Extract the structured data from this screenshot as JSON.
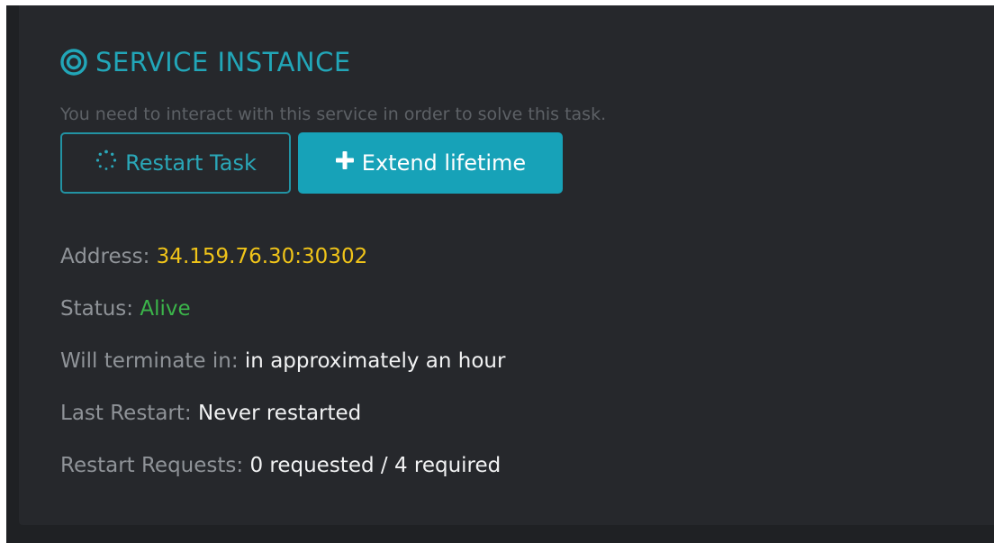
{
  "card": {
    "title": "SERVICE INSTANCE",
    "subtitle": "You need to interact with this service in order to solve this task."
  },
  "buttons": {
    "restart_label": "Restart Task",
    "extend_label": "Extend lifetime"
  },
  "info": {
    "address_label": "Address:",
    "address_value": "34.159.76.30:30302",
    "status_label": "Status:",
    "status_value": "Alive",
    "terminate_label": "Will terminate in:",
    "terminate_value": "in approximately an hour",
    "last_restart_label": "Last Restart:",
    "last_restart_value": "Never restarted",
    "restart_requests_label": "Restart Requests:",
    "restart_requests_value": "0 requested / 4 required"
  },
  "icons": {
    "title_icon": "target-icon",
    "restart_icon": "spinner-icon",
    "extend_icon": "plus-icon"
  },
  "colors": {
    "background": "#26282c",
    "accent": "#17a2b8",
    "address": "#f0c419",
    "status_alive": "#3bb54a",
    "label": "#8f9398",
    "value": "#f1f2f3"
  }
}
